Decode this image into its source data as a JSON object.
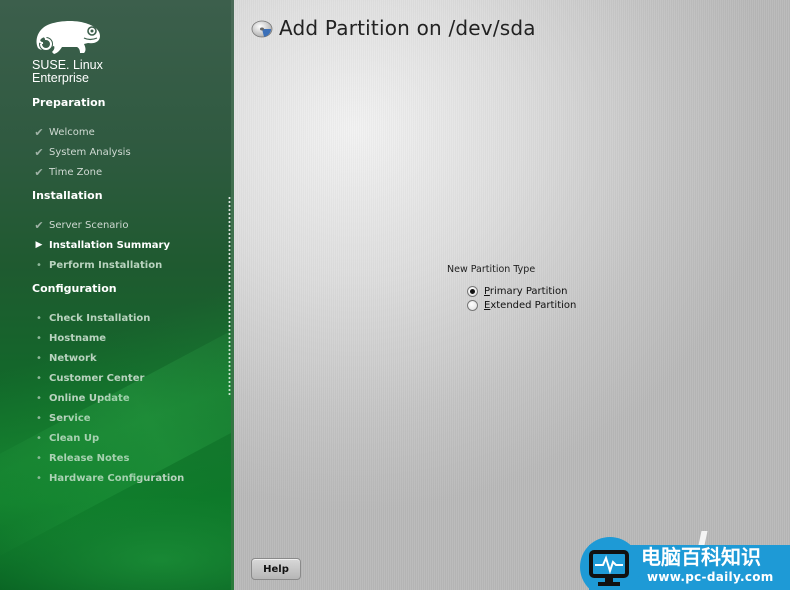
{
  "sidebar": {
    "brand_line1": "SUSE. Linux",
    "brand_line2": "Enterprise",
    "logo_icon": "chameleon-logo-icon",
    "sections": [
      {
        "heading": "Preparation",
        "steps": [
          {
            "label": "Welcome",
            "state": "done",
            "icon": "checkmark-icon"
          },
          {
            "label": "System Analysis",
            "state": "done",
            "icon": "checkmark-icon"
          },
          {
            "label": "Time Zone",
            "state": "done",
            "icon": "checkmark-icon"
          }
        ]
      },
      {
        "heading": "Installation",
        "steps": [
          {
            "label": "Server Scenario",
            "state": "done",
            "icon": "checkmark-icon"
          },
          {
            "label": "Installation Summary",
            "state": "current",
            "icon": "play-arrow-icon"
          },
          {
            "label": "Perform Installation",
            "state": "todo",
            "icon": "bullet-icon"
          }
        ]
      },
      {
        "heading": "Configuration",
        "steps": [
          {
            "label": "Check Installation",
            "state": "todo",
            "icon": "bullet-icon"
          },
          {
            "label": "Hostname",
            "state": "todo",
            "icon": "bullet-icon"
          },
          {
            "label": "Network",
            "state": "todo",
            "icon": "bullet-icon"
          },
          {
            "label": "Customer Center",
            "state": "todo",
            "icon": "bullet-icon"
          },
          {
            "label": "Online Update",
            "state": "todo",
            "icon": "bullet-icon"
          },
          {
            "label": "Service",
            "state": "todo",
            "icon": "bullet-icon"
          },
          {
            "label": "Clean Up",
            "state": "todo",
            "icon": "bullet-icon"
          },
          {
            "label": "Release Notes",
            "state": "todo",
            "icon": "bullet-icon"
          },
          {
            "label": "Hardware Configuration",
            "state": "todo",
            "icon": "bullet-icon"
          }
        ]
      }
    ],
    "glyphs": {
      "done": "✔",
      "current": "▶",
      "todo": "•"
    }
  },
  "main": {
    "title": "Add Partition on /dev/sda",
    "title_icon": "disk-partition-icon",
    "partition_type": {
      "label": "New Partition Type",
      "options": [
        {
          "mnemonic": "P",
          "rest": "rimary Partition",
          "label": "Primary Partition",
          "checked": true
        },
        {
          "mnemonic": "E",
          "rest": "xtended Partition",
          "label": "Extended Partition",
          "checked": false
        }
      ]
    },
    "help_label": "Help"
  },
  "watermark": {
    "chinese_text": "电脑百科知识",
    "url": "www.pc-daily.com"
  },
  "colors": {
    "sidebar_green": "#1f5a30",
    "watermark_blue": "#1e9ad6"
  }
}
